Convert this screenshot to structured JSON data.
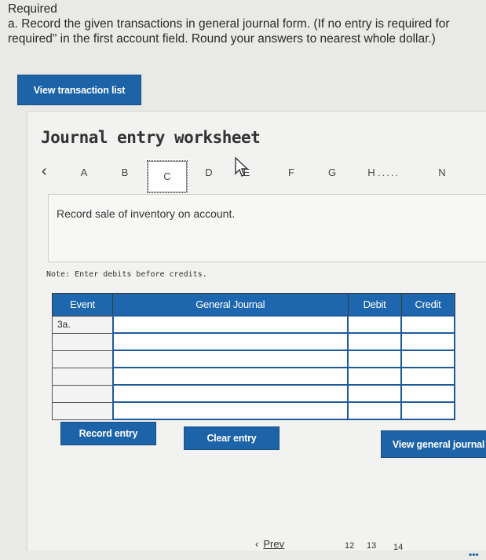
{
  "instructions": {
    "heading": "Required",
    "line1": "a. Record the given transactions in general journal form. (If no entry is required for",
    "line2": "required\" in the first account field. Round your answers to nearest whole dollar.)"
  },
  "buttons": {
    "view_transaction_list": "View transaction list",
    "record_entry": "Record entry",
    "clear_entry": "Clear entry",
    "view_general_journal": "View general journal"
  },
  "worksheet": {
    "title": "Journal entry worksheet",
    "tabs": [
      "A",
      "B",
      "C",
      "D",
      "E",
      "F",
      "G",
      "H",
      "N"
    ],
    "active_tab": "C",
    "ellipsis": ".....",
    "description": "Record sale of inventory on account.",
    "note": "Note: Enter debits before credits."
  },
  "table": {
    "headers": {
      "event": "Event",
      "journal": "General Journal",
      "debit": "Debit",
      "credit": "Credit"
    },
    "rows": [
      {
        "event": "3a.",
        "journal": "",
        "debit": "",
        "credit": ""
      },
      {
        "event": "",
        "journal": "",
        "debit": "",
        "credit": ""
      },
      {
        "event": "",
        "journal": "",
        "debit": "",
        "credit": ""
      },
      {
        "event": "",
        "journal": "",
        "debit": "",
        "credit": ""
      },
      {
        "event": "",
        "journal": "",
        "debit": "",
        "credit": ""
      },
      {
        "event": "",
        "journal": "",
        "debit": "",
        "credit": ""
      }
    ]
  },
  "pagination": {
    "prev_label": "Prev",
    "pages": [
      "12",
      "13",
      "14"
    ]
  },
  "colors": {
    "accent_blue": "#1d63a8",
    "header_blue": "#1e66ad",
    "background": "#e9e9e6"
  }
}
